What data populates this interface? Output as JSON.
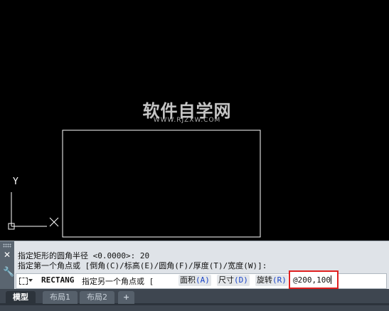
{
  "watermark": {
    "title": "软件自学网",
    "subtitle": "WWW.RJZXW.COM"
  },
  "ucs": {
    "y_label": "Y"
  },
  "command_history": {
    "line1": "指定矩形的圆角半径 <0.0000>: 20",
    "line2": "指定第一个角点或 [倒角(C)/标高(E)/圆角(F)/厚度(T)/宽度(W)]:"
  },
  "command_input": {
    "command_name": "RECTANG",
    "prompt": "指定另一个角点或 [",
    "options": [
      {
        "label": "面积",
        "key": "(A)"
      },
      {
        "label": "尺寸",
        "key": "(D)"
      },
      {
        "label": "旋转",
        "key": "(R)"
      }
    ],
    "close_bracket": "]:",
    "typed_value": "@200,100"
  },
  "layout_tabs": {
    "model": "模型",
    "layout1": "布局1",
    "layout2": "布局2",
    "add": "+"
  },
  "colors": {
    "canvas_bg": "#000000",
    "highlight_box": "#e02020",
    "option_key": "#1a44c8"
  }
}
